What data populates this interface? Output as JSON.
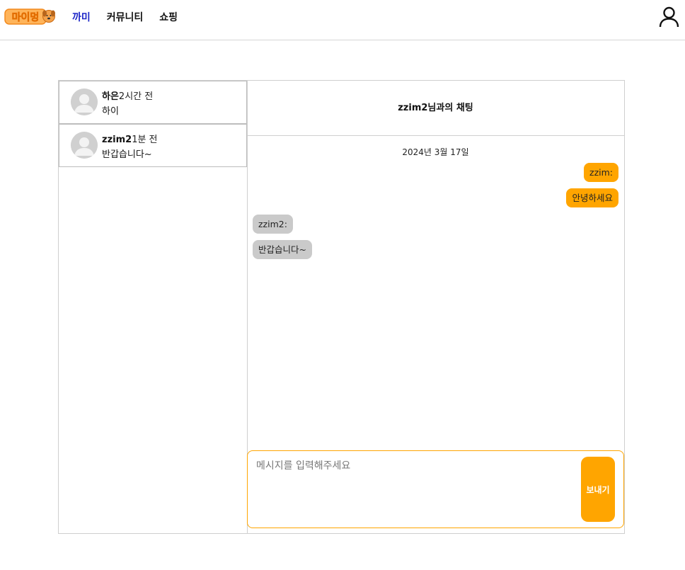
{
  "header": {
    "logo_text": "마이멍",
    "nav": [
      "까미",
      "커뮤니티",
      "쇼핑"
    ],
    "accent_color": "#1e28c8"
  },
  "rooms": [
    {
      "name": "하은",
      "time": "2시간 전",
      "last_message": "하이"
    },
    {
      "name": "zzim2",
      "time": "1분 전",
      "last_message": "반갑습니다~"
    }
  ],
  "chat": {
    "title": "zzim2님과의 채팅",
    "date": "2024년 3월 17일",
    "messages": [
      {
        "side": "mine",
        "text": "zzim:"
      },
      {
        "side": "mine",
        "text": "안녕하세요"
      },
      {
        "side": "other",
        "text": "zzim2:"
      },
      {
        "side": "other",
        "text": "반갑습니다~"
      }
    ],
    "input_placeholder": "메시지를 입력해주세요",
    "send_label": "보내기"
  },
  "colors": {
    "mine_bubble": "#ffa500",
    "other_bubble": "#cacaca",
    "border": "#cfcfcf"
  },
  "icons": [
    "user-icon",
    "avatar-icon"
  ]
}
